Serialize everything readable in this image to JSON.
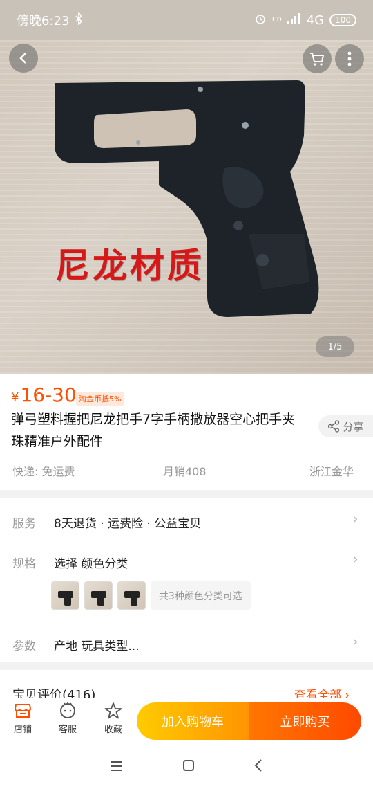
{
  "status_bar": {
    "time": "傍晚6:23",
    "network": "4G",
    "hd": "HD",
    "battery": "100"
  },
  "gallery": {
    "overlay_text": "尼龙材质",
    "counter": "1/5"
  },
  "product": {
    "price_symbol": "¥",
    "price": "16-30",
    "coin_tag": "淘金币抵5%",
    "title": "弹弓塑料握把尼龙把手7字手柄撒放器空心把手夹珠精准户外配件",
    "share_label": "分享",
    "shipping": "快递: 免运费",
    "monthly_sales": "月销408",
    "location": "浙江金华"
  },
  "service": {
    "label": "服务",
    "value": "8天退货 · 运费险 · 公益宝贝"
  },
  "specs": {
    "label": "规格",
    "value": "选择 颜色分类",
    "options_note": "共3种颜色分类可选"
  },
  "params": {
    "label": "参数",
    "value": "产地 玩具类型..."
  },
  "reviews": {
    "title": "宝贝评价(416)",
    "more": "查看全部"
  },
  "bottom": {
    "store": "店铺",
    "service": "客服",
    "favorite": "收藏",
    "add_to_cart": "加入购物车",
    "buy_now": "立即购买"
  },
  "colors": {
    "accent": "#ff5000",
    "cart_gradient": [
      "#ffcb00",
      "#ff9402"
    ],
    "buy_gradient": [
      "#ff7700",
      "#ff4900"
    ]
  }
}
